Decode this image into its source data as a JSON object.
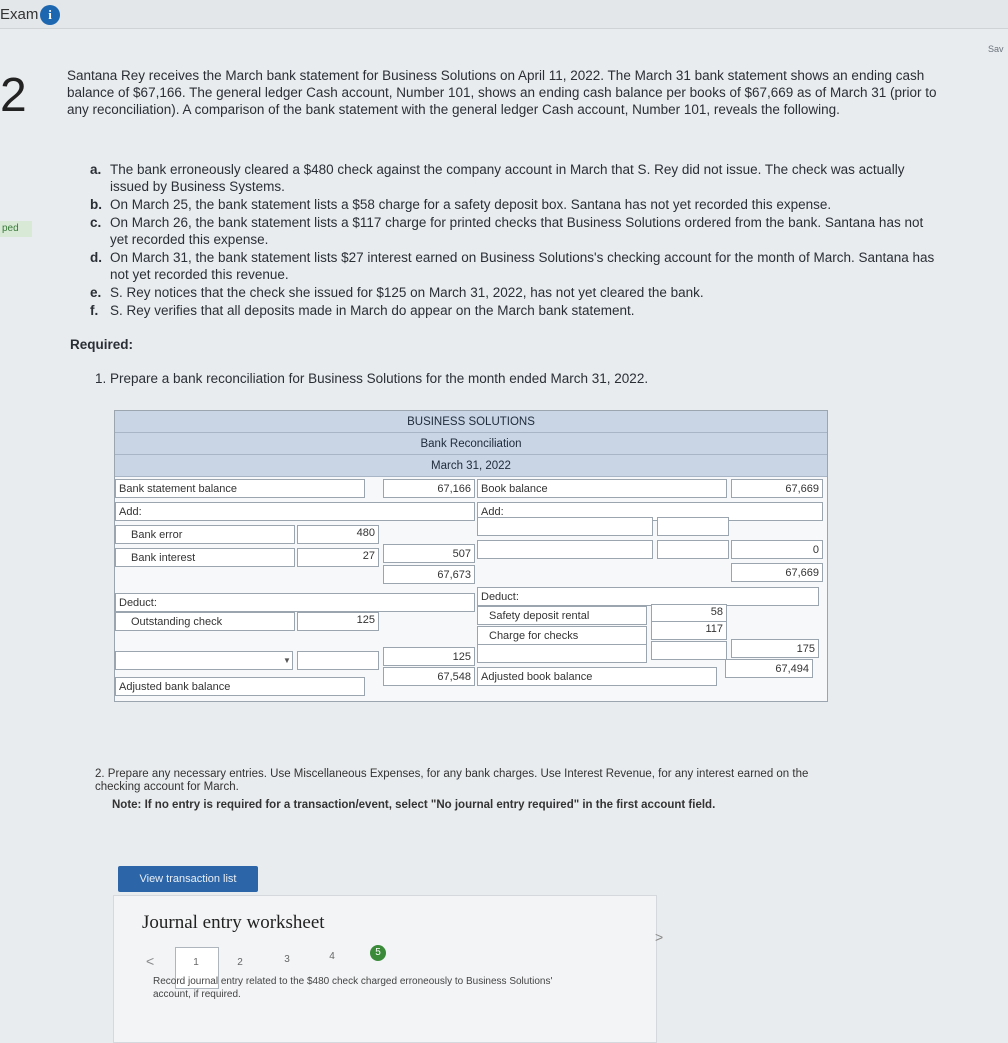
{
  "header": {
    "exam_label": "Exam",
    "info_glyph": "i",
    "save_label": "Sav"
  },
  "question_number": "2",
  "side_tag": "ped",
  "problem": {
    "paragraph": "Santana Rey receives the March bank statement for Business Solutions on April 11, 2022. The March 31 bank statement shows an ending cash balance of $67,166. The general ledger Cash account, Number 101, shows an ending cash balance per books of $67,669 as of March 31 (prior to any reconciliation). A comparison of the bank statement with the general ledger Cash account, Number 101, reveals the following.",
    "items": [
      {
        "letter": "a.",
        "text": "The bank erroneously cleared a $480 check against the company account in March that S. Rey did not issue. The check was actually issued by Business Systems."
      },
      {
        "letter": "b.",
        "text": "On March 25, the bank statement lists a $58 charge for a safety deposit box. Santana has not yet recorded this expense."
      },
      {
        "letter": "c.",
        "text": "On March 26, the bank statement lists a $117 charge for printed checks that Business Solutions ordered from the bank. Santana has not yet recorded this expense."
      },
      {
        "letter": "d.",
        "text": "On March 31, the bank statement lists $27 interest earned on Business Solutions's checking account for the month of March. Santana has not yet recorded this revenue."
      },
      {
        "letter": "e.",
        "text": "S. Rey notices that the check she issued for $125 on March 31, 2022, has not yet cleared the bank."
      },
      {
        "letter": "f.",
        "text": "S. Rey verifies that all deposits made in March do appear on the March bank statement."
      }
    ],
    "required_label": "Required:",
    "required_1": "1. Prepare a bank reconciliation for Business Solutions for the month ended March 31, 2022."
  },
  "recon": {
    "company": "BUSINESS SOLUTIONS",
    "title": "Bank Reconciliation",
    "date": "March 31, 2022",
    "dollar": "$",
    "bank_side": {
      "balance_label": "Bank statement balance",
      "balance_value": "67,166",
      "add_label": "Add:",
      "add_rows": [
        {
          "label": "Bank error",
          "value": "480"
        },
        {
          "label": "Bank interest",
          "value": "27"
        }
      ],
      "add_total": "507",
      "subtotal": "67,673",
      "deduct_label": "Deduct:",
      "deduct_rows": [
        {
          "label": "Outstanding check",
          "value": "125"
        }
      ],
      "deduct_total": "125",
      "adjusted_label": "Adjusted bank balance",
      "adjusted_value": "67,548"
    },
    "book_side": {
      "balance_label": "Book balance",
      "balance_value": "67,669",
      "add_label": "Add:",
      "add_total": "0",
      "subtotal": "67,669",
      "deduct_label": "Deduct:",
      "deduct_rows": [
        {
          "label": "Safety deposit rental",
          "value": "58"
        },
        {
          "label": "Charge for checks",
          "value": "117"
        }
      ],
      "deduct_total": "175",
      "adjusted_label": "Adjusted book balance",
      "adjusted_value": "67,494"
    }
  },
  "part2": {
    "text": "2. Prepare any necessary entries. Use Miscellaneous Expenses, for any bank charges. Use Interest Revenue, for any interest earned on the checking account for March.",
    "note": "Note: If no entry is required for a transaction/event, select \"No journal entry required\" in the first account field.",
    "view_button": "View transaction list",
    "worksheet_title": "Journal entry worksheet",
    "steps": [
      "1",
      "2",
      "3",
      "4",
      "5"
    ],
    "prev_glyph": "<",
    "next_glyph": ">",
    "description": "Record journal entry related to the $480 check charged erroneously to Business Solutions' account, if required."
  }
}
